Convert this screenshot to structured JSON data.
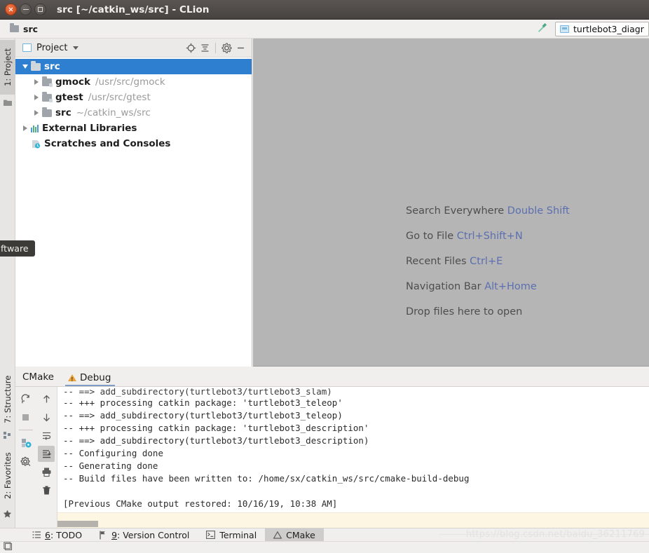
{
  "window": {
    "title": "src [~/catkin_ws/src] - CLion",
    "buttons": {
      "close": "close-button",
      "minimize": "minimize-button",
      "maximize": "maximize-button"
    }
  },
  "navbar": {
    "breadcrumb": "src",
    "build_icon": "hammer-icon",
    "run_config": {
      "label": "turtlebot3_diagr",
      "icon": "run-configuration-icon"
    }
  },
  "left_strip": {
    "project_tab": "1: Project",
    "project_tab_icon": "project-folder-icon"
  },
  "bottom_left_strip": {
    "structure_tab": "7: Structure",
    "structure_icon": "structure-icon",
    "favorites_tab": "2: Favorites",
    "favorites_icon": "star-icon"
  },
  "project_panel": {
    "title": "Project",
    "toolbar": [
      "locate-icon",
      "collapse-all-icon",
      "settings-gear-icon",
      "hide-icon"
    ],
    "tree": [
      {
        "name": "src",
        "path": "",
        "depth": 0,
        "expanded": true,
        "selected": true,
        "icon": "folder-module-icon"
      },
      {
        "name": "gmock",
        "path": "/usr/src/gmock",
        "depth": 1,
        "expanded": false,
        "selected": false,
        "icon": "folder-source-icon"
      },
      {
        "name": "gtest",
        "path": "/usr/src/gtest",
        "depth": 1,
        "expanded": false,
        "selected": false,
        "icon": "folder-source-icon"
      },
      {
        "name": "src",
        "path": "~/catkin_ws/src",
        "depth": 1,
        "expanded": false,
        "selected": false,
        "icon": "folder-icon"
      },
      {
        "name": "External Libraries",
        "path": "",
        "depth": 0,
        "expanded": false,
        "selected": false,
        "icon": "libraries-icon"
      },
      {
        "name": "Scratches and Consoles",
        "path": "",
        "depth": 0,
        "expanded": null,
        "selected": false,
        "icon": "scratches-icon"
      }
    ]
  },
  "editor": {
    "hints": [
      {
        "action": "Search Everywhere",
        "shortcut": "Double Shift"
      },
      {
        "action": "Go to File",
        "shortcut": "Ctrl+Shift+N"
      },
      {
        "action": "Recent Files",
        "shortcut": "Ctrl+E"
      },
      {
        "action": "Navigation Bar",
        "shortcut": "Alt+Home"
      },
      {
        "action": "Drop files here to open",
        "shortcut": ""
      }
    ]
  },
  "tooltip": {
    "text": "ftware"
  },
  "bottom_panel": {
    "title": "CMake",
    "subtab": {
      "label": "Debug",
      "icon": "warning-triangle-icon",
      "selected": true
    },
    "toolbar_left": [
      "rerun-cmake-icon",
      "stop-icon",
      "build-type-icon",
      "cmake-settings-icon"
    ],
    "toolbar_right": [
      "previous-occurrence-icon",
      "next-occurrence-icon",
      "soft-wrap-icon",
      "scroll-to-end-icon",
      "print-icon",
      "delete-icon"
    ],
    "console_lines": [
      "-- ==> add_subdirectory(turtlebot3/turtlebot3_slam)",
      "-- +++ processing catkin package: 'turtlebot3_teleop'",
      "-- ==> add_subdirectory(turtlebot3/turtlebot3_teleop)",
      "-- +++ processing catkin package: 'turtlebot3_description'",
      "-- ==> add_subdirectory(turtlebot3/turtlebot3_description)",
      "-- Configuring done",
      "-- Generating done",
      "-- Build files have been written to: /home/sx/catkin_ws/src/cmake-build-debug",
      "",
      "[Previous CMake output restored: 10/16/19, 10:38 AM]"
    ]
  },
  "bottom_tabs": [
    {
      "label": "6: TODO",
      "num": "6",
      "rest": ": TODO",
      "icon": "todo-icon",
      "selected": false
    },
    {
      "label": "9: Version Control",
      "num": "9",
      "rest": ": Version Control",
      "icon": "version-control-icon",
      "selected": false
    },
    {
      "label": "Terminal",
      "num": "",
      "rest": "Terminal",
      "icon": "terminal-icon",
      "selected": false
    },
    {
      "label": "CMake",
      "num": "",
      "rest": "CMake",
      "icon": "warning-triangle-icon",
      "selected": true
    }
  ],
  "statusbar": {
    "icon": "tool-windows-icon"
  },
  "watermark": "https://blog.csdn.net/baidu_36211769",
  "colors": {
    "selection_blue": "#2f7fd1",
    "link_blue": "#5c6fb0",
    "editor_bg": "#b5b5b5",
    "warning_orange": "#e8a33d",
    "console_strip": "#fdf6e3"
  }
}
